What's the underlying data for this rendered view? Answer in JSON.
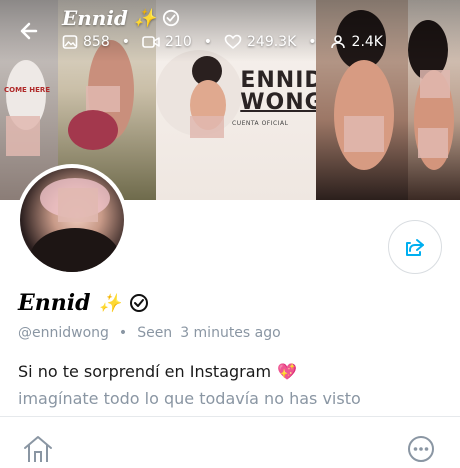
{
  "header": {
    "title": "Ennid",
    "title_emoji": "✨",
    "stats": {
      "photos": "858",
      "videos": "210",
      "likes": "249.3K",
      "fans": "2.4K"
    }
  },
  "banner": {
    "brand_line1": "ENNID",
    "brand_line2": "WONG",
    "brand_sub": "CUENTA OFICIAL",
    "shirt_text": "COME HERE"
  },
  "profile": {
    "name": "Ennid",
    "name_emoji": "✨",
    "handle": "@ennidwong",
    "seen_label": "Seen",
    "seen_time": "3 minutes ago",
    "bio_line1": "Si no te sorprendí en Instagram",
    "bio_emoji": "💖",
    "bio_line2": "imagínate todo lo que todavía no has visto"
  },
  "colors": {
    "accent": "#00aff0",
    "muted": "#8a96a3"
  }
}
